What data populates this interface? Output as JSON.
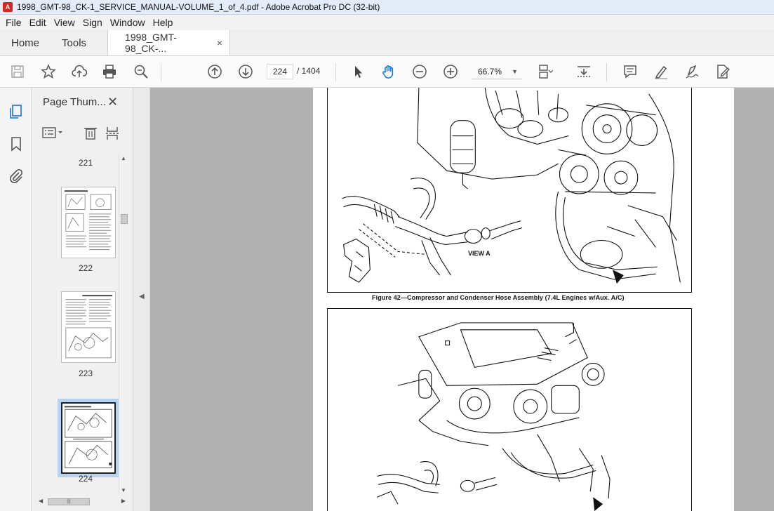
{
  "window": {
    "title": "1998_GMT-98_CK-1_SERVICE_MANUAL-VOLUME_1_of_4.pdf - Adobe Acrobat Pro DC (32-bit)"
  },
  "menu": [
    "File",
    "Edit",
    "View",
    "Sign",
    "Window",
    "Help"
  ],
  "tabs": {
    "home": "Home",
    "tools": "Tools",
    "document": "1998_GMT-98_CK-...",
    "close": "×"
  },
  "toolbar": {
    "current_page": "224",
    "page_total": "/ 1404",
    "zoom": "66.7%"
  },
  "panel": {
    "title": "Page Thum...",
    "close": "✕"
  },
  "thumbnails": [
    {
      "label": "221"
    },
    {
      "label": "222"
    },
    {
      "label": "223"
    },
    {
      "label": "224",
      "selected": true
    }
  ],
  "document": {
    "figure_caption": "Figure 42—Compressor and Condenser Hose Assembly (7.4L Engines w/Aux. A/C)",
    "view_label": "VIEW A"
  },
  "colors": {
    "accent": "#1473e6",
    "selection": "#b7d3f2",
    "viewer_bg": "#b1b1b1"
  }
}
